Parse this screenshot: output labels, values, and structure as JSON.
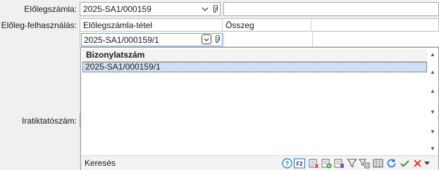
{
  "form": {
    "advance_invoice_label": "Előlegszámla:",
    "advance_invoice_value": "2025-SA1/000159",
    "advance_usage_label": "Előleg-felhasználás:",
    "filing_number_label": "Iratiktatószám:"
  },
  "grid": {
    "columns": [
      "Előlegszámla-tétel",
      "Összeg"
    ],
    "row_value": "2025-SA1/000159/1"
  },
  "lookup": {
    "column_header": "Bizonylatszám",
    "rows": [
      "2025-SA1/000159/1"
    ],
    "search_label": "Keresés"
  },
  "icons": {
    "help": "help-icon",
    "f2": "F2",
    "accent_ok": "#2e9e2e",
    "accent_cancel": "#d42a2a",
    "accent_blue": "#1f6fd1",
    "selection": "#cfe0f4"
  }
}
